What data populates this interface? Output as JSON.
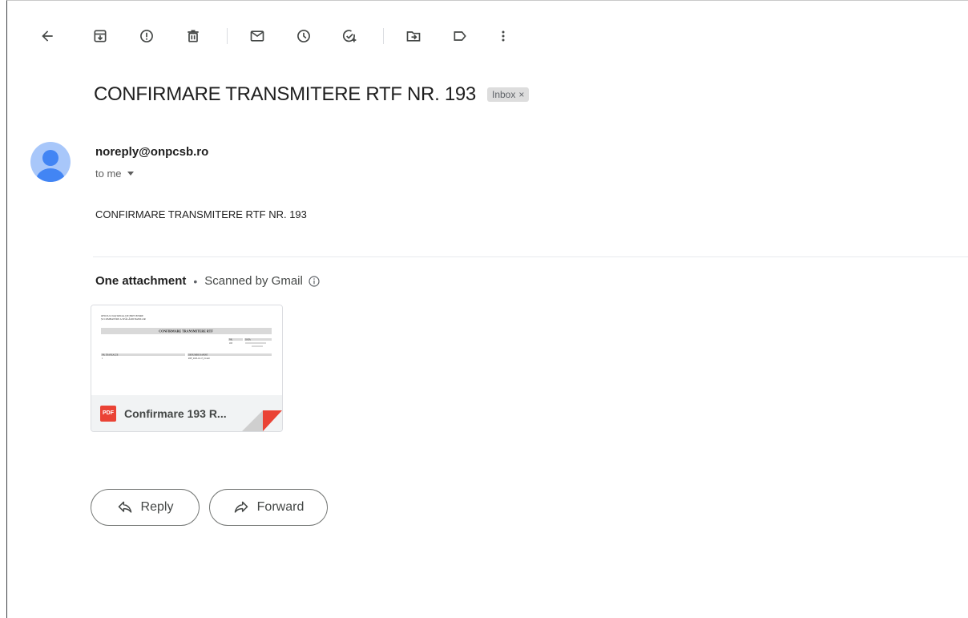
{
  "toolbar": {
    "icons": [
      "back-arrow-icon",
      "archive-icon",
      "report-spam-icon",
      "delete-icon",
      "mark-unread-icon",
      "snooze-icon",
      "add-task-icon",
      "move-to-icon",
      "label-icon",
      "more-vert-icon"
    ]
  },
  "email": {
    "subject": "CONFIRMARE TRANSMITERE RTF NR. 193",
    "label": "Inbox",
    "label_close": "×",
    "sender": "noreply@onpcsb.ro",
    "recipient": "to me",
    "body": "CONFIRMARE TRANSMITERE RTF NR. 193"
  },
  "attachments": {
    "count_text": "One attachment",
    "separator": "•",
    "scan_text": "Scanned by Gmail",
    "items": [
      {
        "type_badge": "PDF",
        "name": "Confirmare 193 R...",
        "preview": {
          "header_lines": [
            "OFICIUL NAȚIONAL DE PREVENIRE",
            "ȘI COMBATERE A SPĂLĂRII BANILOR"
          ],
          "title": "CONFIRMARE TRANSMITERE RTF",
          "nr_label": "NR.",
          "nr_value": "193",
          "data_label": "DATA",
          "col1_label": "NR. TRANZACȚII",
          "col1_value": "1",
          "col2_label": "DENUMIRE RAPORT",
          "col2_value": "RTF_2023-10-17_01.xml"
        }
      }
    ]
  },
  "actions": {
    "reply": "Reply",
    "forward": "Forward"
  },
  "colors": {
    "avatar_bg": "#a8c7fa",
    "avatar_fg": "#4285f4",
    "pdf_red": "#ea4335",
    "icon_gray": "#444746"
  }
}
